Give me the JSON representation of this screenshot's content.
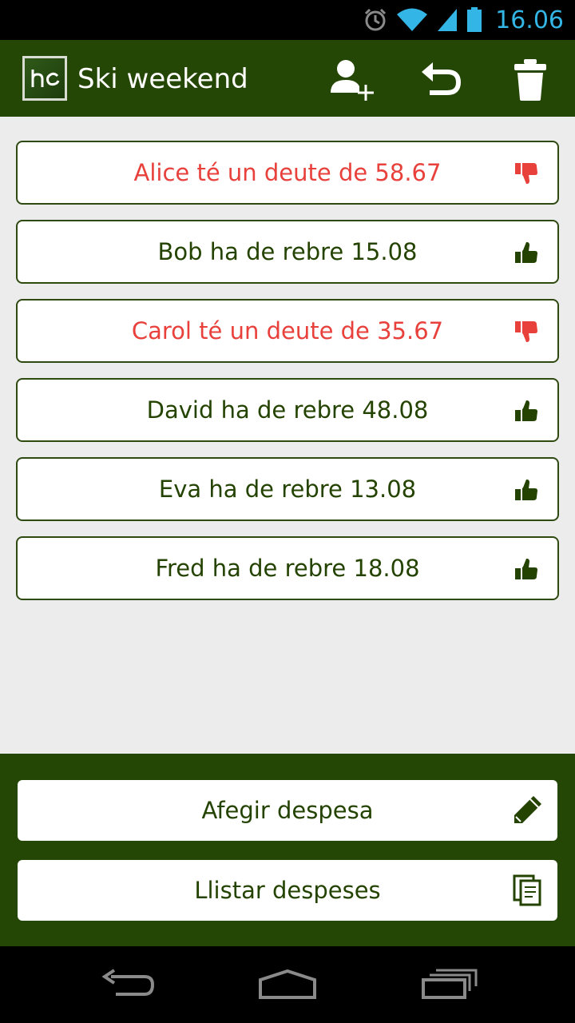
{
  "status_bar": {
    "time": "16.06",
    "icons": [
      "alarm-icon",
      "wifi-icon",
      "signal-icon",
      "battery-icon"
    ],
    "accent_color": "#33b5e5"
  },
  "action_bar": {
    "logo_text": "hc",
    "title": "Ski weekend",
    "actions": [
      "add-person-icon",
      "undo-icon",
      "trash-icon"
    ],
    "background_color": "#254705"
  },
  "balances": [
    {
      "text": "Alice té un deute de 58.67",
      "status": "debt",
      "icon": "thumbs-down-icon"
    },
    {
      "text": "Bob ha de rebre 15.08",
      "status": "credit",
      "icon": "thumbs-up-icon"
    },
    {
      "text": "Carol té un deute de 35.67",
      "status": "debt",
      "icon": "thumbs-down-icon"
    },
    {
      "text": "David ha de rebre 48.08",
      "status": "credit",
      "icon": "thumbs-up-icon"
    },
    {
      "text": "Eva ha de rebre 13.08",
      "status": "credit",
      "icon": "thumbs-up-icon"
    },
    {
      "text": "Fred ha de rebre 18.08",
      "status": "credit",
      "icon": "thumbs-up-icon"
    }
  ],
  "colors": {
    "debt": "#e8413c",
    "credit": "#244300"
  },
  "bottom_panel": {
    "add_expense_label": "Afegir despesa",
    "add_expense_icon": "pencil-icon",
    "list_expenses_label": "Llistar despeses",
    "list_expenses_icon": "documents-icon"
  },
  "nav_bar": {
    "buttons": [
      "back-icon",
      "home-icon",
      "recent-apps-icon"
    ]
  }
}
